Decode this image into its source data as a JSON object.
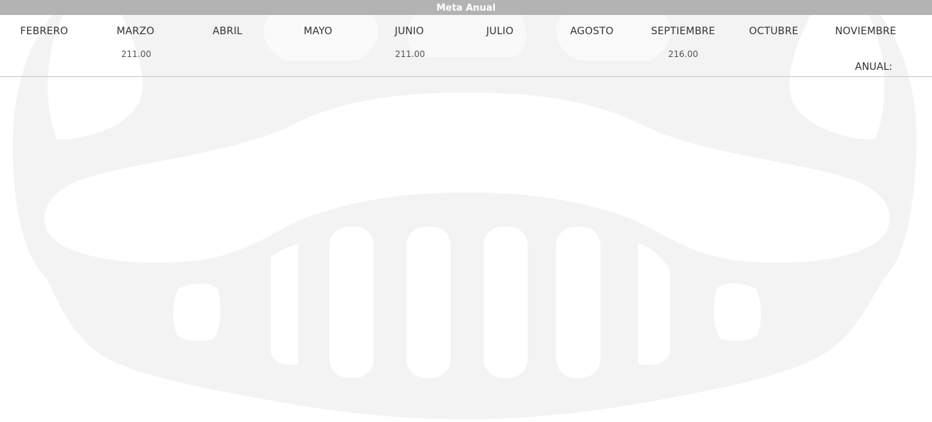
{
  "header": {
    "title": "Meta Anual"
  },
  "months": [
    {
      "label": "FEBRERO",
      "value": ""
    },
    {
      "label": "MARZO",
      "value": "211.00"
    },
    {
      "label": "ABRIL",
      "value": ""
    },
    {
      "label": "MAYO",
      "value": ""
    },
    {
      "label": "JUNIO",
      "value": "211.00"
    },
    {
      "label": "JULIO",
      "value": ""
    },
    {
      "label": "AGOSTO",
      "value": ""
    },
    {
      "label": "SEPTIEMBRE",
      "value": "216.00"
    },
    {
      "label": "OCTUBRE",
      "value": ""
    },
    {
      "label": "NOVIEMBRE",
      "value": ""
    }
  ],
  "annual": {
    "label": "ANUAL:",
    "value": ""
  },
  "colors": {
    "header_bg": "#b3b3b3",
    "header_text": "#ffffff",
    "watermark": "#f2f2f2",
    "divider": "#c8c8c8"
  },
  "watermark_icon": "grille-logo-icon"
}
